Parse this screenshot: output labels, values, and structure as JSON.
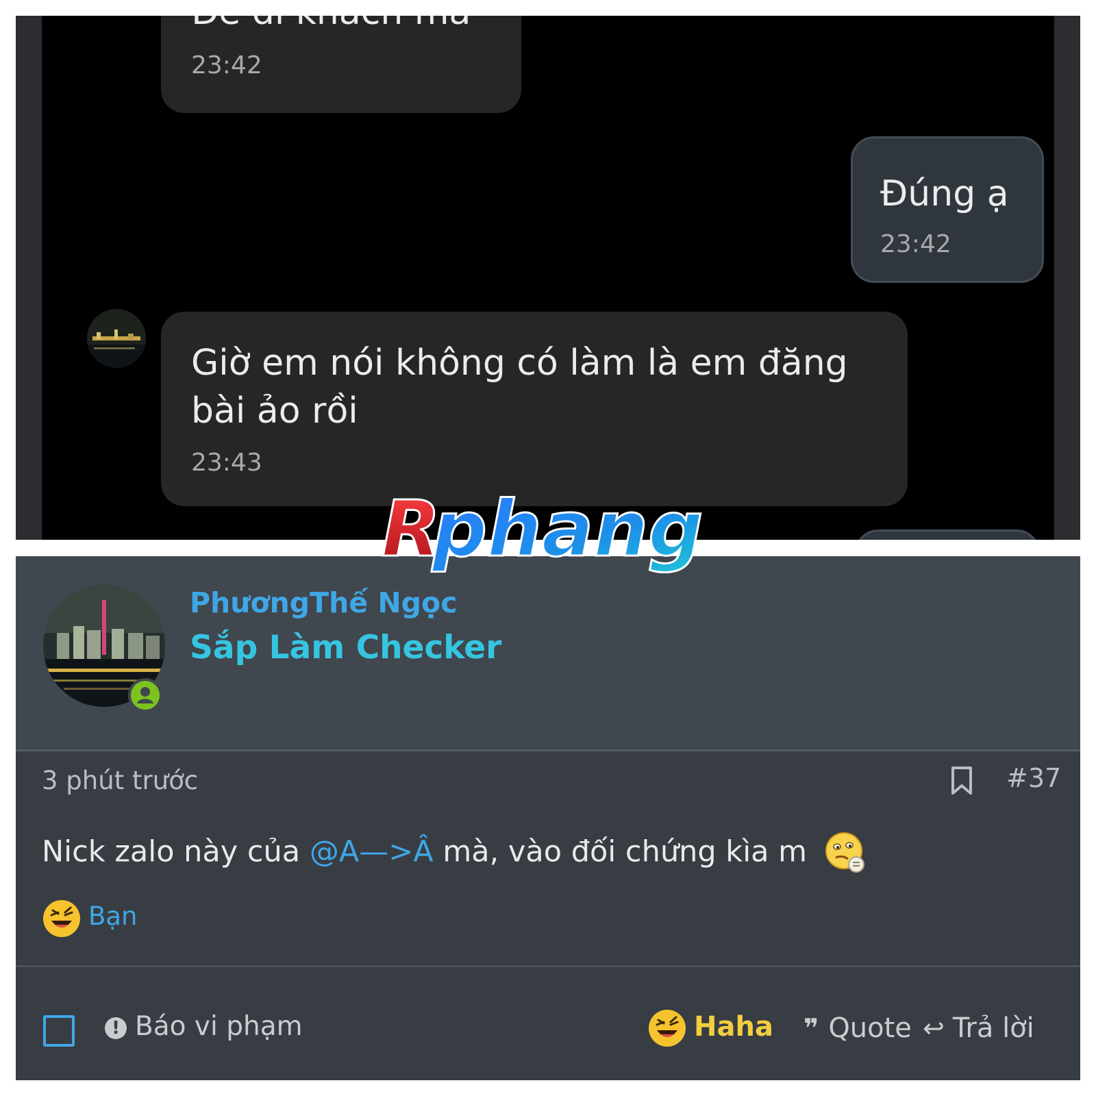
{
  "chat": {
    "messages": [
      {
        "direction": "incoming",
        "text": "Đe đi khách mà",
        "time": "23:42"
      },
      {
        "direction": "outgoing",
        "text": "Đúng ạ",
        "time": "23:42"
      },
      {
        "direction": "incoming",
        "text": "Giờ em nói không có làm là em đăng bài ảo rồi",
        "time": "23:43"
      }
    ]
  },
  "watermark": {
    "text": "Rphang"
  },
  "post": {
    "author": {
      "name": "PhươngThế Ngọc",
      "title": "Sắp Làm Checker",
      "status": "online"
    },
    "time_ago": "3 phút trước",
    "number": "#37",
    "body": {
      "before": "Nick zalo này của ",
      "mention": "@A—>Â",
      "after": " mà, vào đối chứng kìa m"
    },
    "reactions": {
      "emoji": "haha-icon",
      "users": "Bạn"
    },
    "footer": {
      "report": "Báo vi phạm",
      "reaction": "Haha",
      "quote": "Quote",
      "reply": "Trả lời"
    }
  },
  "colors": {
    "link": "#3fa7e6",
    "user_title": "#36c5e0",
    "haha": "#f4ce3f",
    "online": "#7cc320"
  }
}
